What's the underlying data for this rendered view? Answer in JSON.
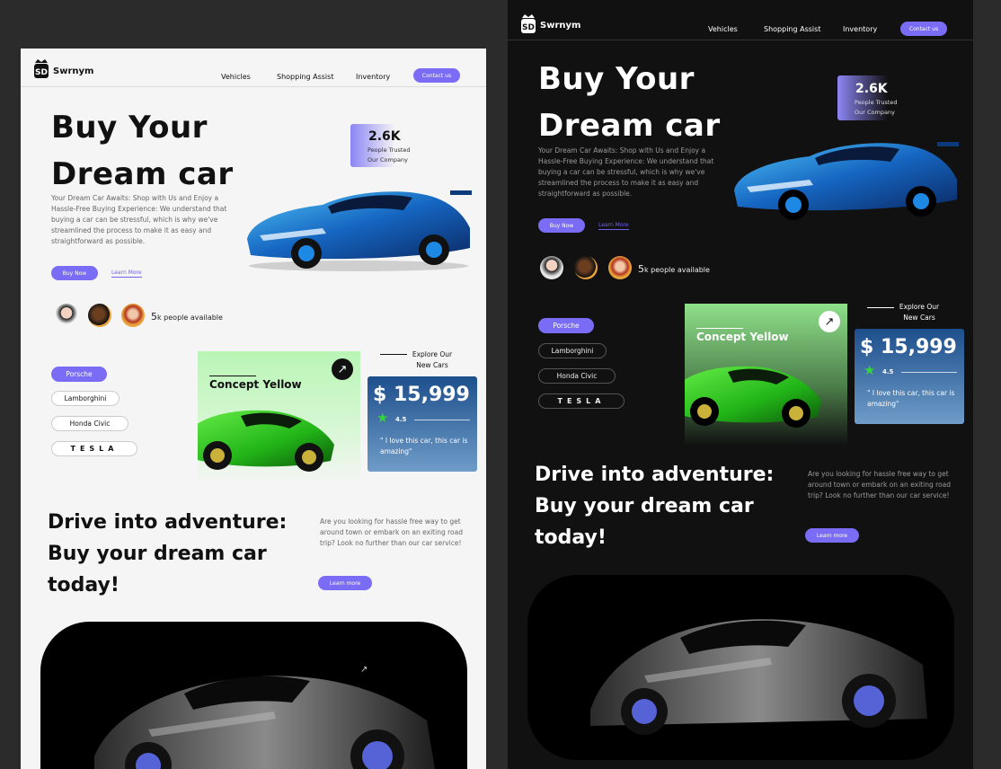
{
  "brand": {
    "name": "Swrnym"
  },
  "nav": {
    "items": [
      "Vehicles",
      "Shopping Assist",
      "Inventory"
    ],
    "contact": "Contact us"
  },
  "hero": {
    "title_line1": "Buy Your",
    "title_line2": "Dream car",
    "description": "Your Dream Car Awaits: Shop with Us and Enjoy a Hassle-Free Buying Experience: We understand that buying a car can be stressful, which is why we've streamlined the process to make it as easy and straightforward as possible.",
    "buy_now": "Buy Now",
    "learn_more": "Learn More"
  },
  "trust": {
    "count": "2.6K",
    "label_line1": "People Trusted",
    "label_line2": "Our Company"
  },
  "availability": {
    "number": "5",
    "text": "k people available"
  },
  "brands": [
    "Porsche",
    "Lamborghini",
    "Honda Civic",
    "TESLA"
  ],
  "concept": {
    "title": "Concept Yellow",
    "arrow": "↗"
  },
  "explore": {
    "line1": "Explore Our",
    "line2": "New Cars"
  },
  "offer": {
    "price": "$ 15,999",
    "rating": "4.5",
    "quote": "\" I love this car, this car is amazing\""
  },
  "adventure": {
    "line1": "Drive into adventure:",
    "line2": "Buy your dream car",
    "line3": "today!",
    "description": "Are you looking for hassle free way to get around town or embark on an exiting road trip? Look no further than our car service!",
    "learn_more": "Learn more"
  },
  "colors": {
    "accent": "#7b6cf6",
    "star": "#35d43b",
    "light_bg": "#f5f5f5",
    "dark_bg": "#111111"
  },
  "icons": {
    "logo": "sd-crown-logo",
    "arrow": "arrow-up-right-icon",
    "star": "star-icon"
  }
}
